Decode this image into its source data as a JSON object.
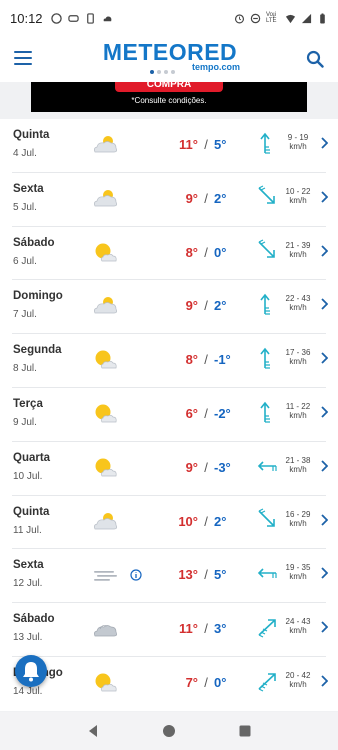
{
  "status_bar": {
    "time": "10:12",
    "volte_label": "Voɟi LTE"
  },
  "header": {
    "logo": "METEORED",
    "logo_sub": "tempo.com"
  },
  "ad": {
    "button_label": "COMPRA",
    "note": "*Consulte condições."
  },
  "colors": {
    "brand": "#1477c8",
    "max": "#d32f2f",
    "min": "#1565c0",
    "wind": "#22b0c8"
  },
  "forecast": [
    {
      "day": "Quinta",
      "date": "4 Jul.",
      "icon": "partly-cloudy-icon",
      "max": "11°",
      "min": "5°",
      "wind_dir": "north-wind-icon",
      "wind": "9 - 19",
      "unit": "km/h"
    },
    {
      "day": "Sexta",
      "date": "5 Jul.",
      "icon": "partly-cloudy-icon",
      "max": "9°",
      "min": "2°",
      "wind_dir": "southeast-wind-icon",
      "wind": "10 - 22",
      "unit": "km/h"
    },
    {
      "day": "Sábado",
      "date": "6 Jul.",
      "icon": "sun-cloud-icon",
      "max": "8°",
      "min": "0°",
      "wind_dir": "southeast-wind-icon",
      "wind": "21 - 39",
      "unit": "km/h"
    },
    {
      "day": "Domingo",
      "date": "7 Jul.",
      "icon": "partly-cloudy-icon",
      "max": "9°",
      "min": "2°",
      "wind_dir": "north-wind-icon",
      "wind": "22 - 43",
      "unit": "km/h"
    },
    {
      "day": "Segunda",
      "date": "8 Jul.",
      "icon": "sun-cloud-icon",
      "max": "8°",
      "min": "-1°",
      "wind_dir": "north-wind-icon",
      "wind": "17 - 36",
      "unit": "km/h"
    },
    {
      "day": "Terça",
      "date": "9 Jul.",
      "icon": "sun-cloud-icon",
      "max": "6°",
      "min": "-2°",
      "wind_dir": "north-wind-icon",
      "wind": "11 - 22",
      "unit": "km/h"
    },
    {
      "day": "Quarta",
      "date": "10 Jul.",
      "icon": "sun-cloud-icon",
      "max": "9°",
      "min": "-3°",
      "wind_dir": "west-wind-icon",
      "wind": "21 - 38",
      "unit": "km/h"
    },
    {
      "day": "Quinta",
      "date": "11 Jul.",
      "icon": "partly-cloudy-icon",
      "max": "10°",
      "min": "2°",
      "wind_dir": "southeast-wind-icon",
      "wind": "16 - 29",
      "unit": "km/h"
    },
    {
      "day": "Sexta",
      "date": "12 Jul.",
      "icon": "fog-icon",
      "max": "13°",
      "min": "5°",
      "wind_dir": "west-wind-icon",
      "wind": "19 - 35",
      "unit": "km/h"
    },
    {
      "day": "Sábado",
      "date": "13 Jul.",
      "icon": "cloudy-icon",
      "max": "11°",
      "min": "3°",
      "wind_dir": "northeast-wind-icon",
      "wind": "24 - 43",
      "unit": "km/h"
    },
    {
      "day": "Domingo",
      "date": "14 Jul.",
      "icon": "sun-cloud-icon",
      "max": "7°",
      "min": "0°",
      "wind_dir": "northeast-wind-icon",
      "wind": "20 - 42",
      "unit": "km/h"
    }
  ]
}
